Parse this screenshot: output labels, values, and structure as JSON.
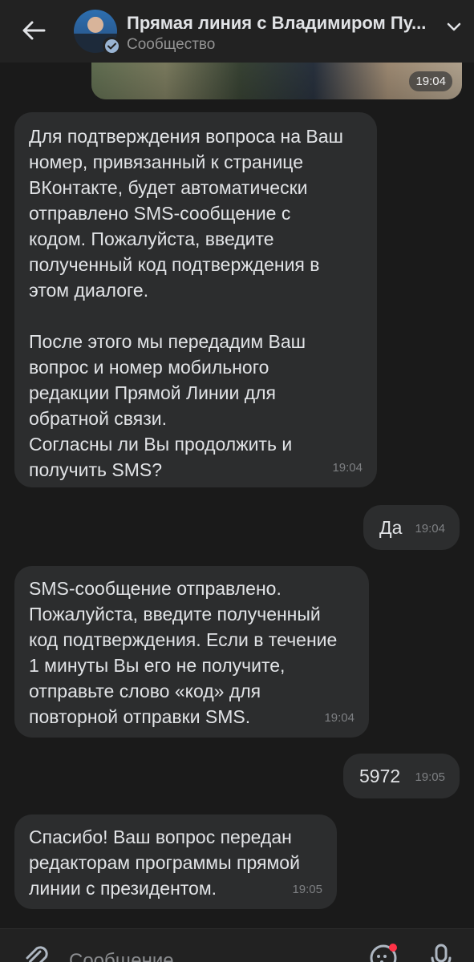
{
  "header": {
    "title": "Прямая линия с Владимиром Пу...",
    "subtitle": "Сообщество",
    "back_icon": "arrow-left-icon",
    "expand_icon": "chevron-down-icon",
    "verified_icon": "checkmark-icon"
  },
  "photo_message": {
    "time": "19:04"
  },
  "messages": [
    {
      "direction": "incoming",
      "text": "Для подтверждения вопроса на Ваш\nномер, привязанный к странице\nВКонтакте, будет автоматически\nотправлено SMS-сообщение с\nкодом. Пожалуйста, введите\nполученный код подтверждения в\nэтом диалоге.\n\nПосле этого мы передадим Ваш\nвопрос и номер мобильного\nредакции Прямой Линии для\nобратной связи.\nСогласны ли Вы продолжить и\nполучить SMS?",
      "time": "19:04"
    },
    {
      "direction": "outgoing",
      "text": "Да",
      "time": "19:04"
    },
    {
      "direction": "incoming",
      "text": "SMS-сообщение отправлено.\nПожалуйста, введите полученный\nкод подтверждения. Если в течение\n1 минуты Вы его не получите,\nотправьте слово «код» для\nповторной отправки SMS.",
      "time": "19:04"
    },
    {
      "direction": "outgoing",
      "text": "5972",
      "time": "19:05"
    },
    {
      "direction": "incoming",
      "text": "Спасибо! Ваш вопрос передан\nредакторам программы прямой\nлинии с президентом.",
      "time": "19:05"
    }
  ],
  "composer": {
    "placeholder": "Сообщение",
    "attach_icon": "paperclip-icon",
    "sticker_icon": "sticker-icon",
    "mic_icon": "microphone-icon"
  },
  "colors": {
    "background": "#1a1a1a",
    "header": "#222222",
    "bubble": "#2c2d2e",
    "text": "#e1e3e6",
    "muted": "#7d7f82",
    "verified": "#99b4d3",
    "notification_dot": "#ff3347"
  }
}
